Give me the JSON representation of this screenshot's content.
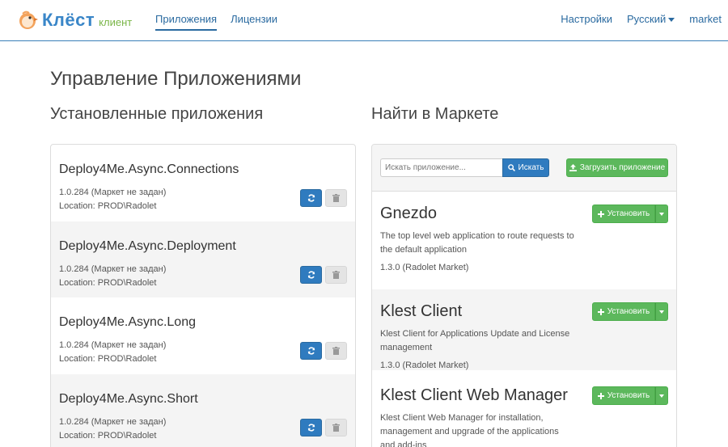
{
  "brand": {
    "name": "Клёст",
    "subtitle": "клиент"
  },
  "nav": {
    "left": [
      {
        "label": "Приложения"
      },
      {
        "label": "Лицензии"
      }
    ],
    "right": {
      "settings": "Настройки",
      "language": "Русский",
      "user": "market"
    }
  },
  "page_title": "Управление Приложениями",
  "installed": {
    "title": "Установленные приложения",
    "items": [
      {
        "name": "Deploy4Me.Async.Connections",
        "version": "1.0.284 (Маркет не задан)",
        "location": "Location: PROD\\Radolet"
      },
      {
        "name": "Deploy4Me.Async.Deployment",
        "version": "1.0.284 (Маркет не задан)",
        "location": "Location: PROD\\Radolet"
      },
      {
        "name": "Deploy4Me.Async.Long",
        "version": "1.0.284 (Маркет не задан)",
        "location": "Location: PROD\\Radolet"
      },
      {
        "name": "Deploy4Me.Async.Short",
        "version": "1.0.284 (Маркет не задан)",
        "location": "Location: PROD\\Radolet"
      }
    ]
  },
  "market": {
    "title": "Найти в Маркете",
    "search_placeholder": "Искать приложение...",
    "search_label": "Искать",
    "upload_label": "Загрузить приложение",
    "install_label": "Установить",
    "items": [
      {
        "name": "Gnezdo",
        "description": "The top level web application to route requests to the default application",
        "version": "1.3.0 (Radolet Market)"
      },
      {
        "name": "Klest Client",
        "description": "Klest Client for Applications Update and License management",
        "version": "1.3.0 (Radolet Market)"
      },
      {
        "name": "Klest Client Web Manager",
        "description": "Klest Client Web Manager for installation, management and upgrade of the applications and add-ins",
        "version": ""
      }
    ]
  },
  "colors": {
    "primary": "#2f7bbf",
    "success": "#5cb85c",
    "link": "#2a6aa0",
    "brand_green": "#7ab648"
  }
}
